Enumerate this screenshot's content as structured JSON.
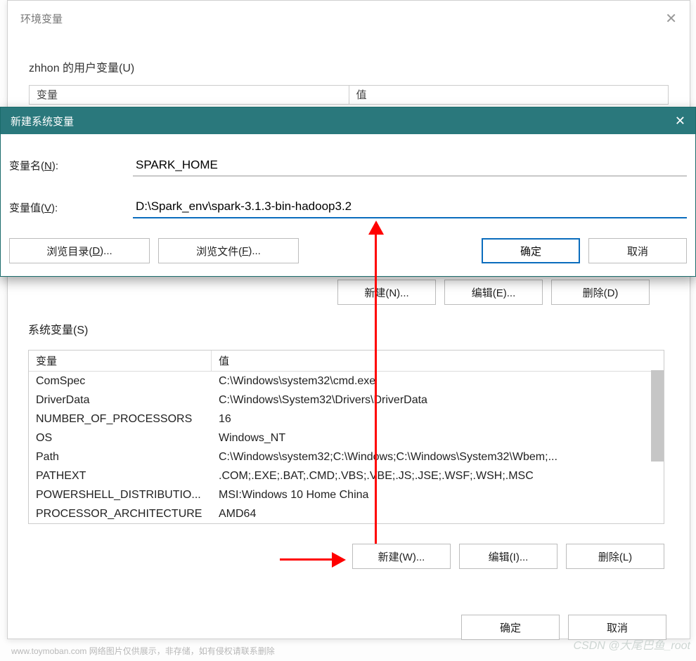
{
  "outerDialog": {
    "title": "环境变量",
    "userVarsHeading": "zhhon 的用户变量(U)",
    "userHeaders": {
      "variable": "变量",
      "value": "值"
    },
    "upperButtons": {
      "new": "新建(N)...",
      "edit": "编辑(E)...",
      "delete": "删除(D)"
    },
    "okcancel": {
      "ok": "确定",
      "cancel": "取消"
    }
  },
  "newSysVar": {
    "title": "新建系统变量",
    "nameLabel": "变量名(N):",
    "nameValue": "SPARK_HOME",
    "valueLabel": "变量值(V):",
    "valueValue": "D:\\Spark_env\\spark-3.1.3-bin-hadoop3.2",
    "browseDir": "浏览目录(D)...",
    "browseFile": "浏览文件(F)...",
    "ok": "确定",
    "cancel": "取消"
  },
  "sysVars": {
    "heading": "系统变量(S)",
    "headers": {
      "variable": "变量",
      "value": "值"
    },
    "rows": [
      {
        "variable": "ComSpec",
        "value": "C:\\Windows\\system32\\cmd.exe"
      },
      {
        "variable": "DriverData",
        "value": "C:\\Windows\\System32\\Drivers\\DriverData"
      },
      {
        "variable": "NUMBER_OF_PROCESSORS",
        "value": "16"
      },
      {
        "variable": "OS",
        "value": "Windows_NT"
      },
      {
        "variable": "Path",
        "value": "C:\\Windows\\system32;C:\\Windows;C:\\Windows\\System32\\Wbem;..."
      },
      {
        "variable": "PATHEXT",
        "value": ".COM;.EXE;.BAT;.CMD;.VBS;.VBE;.JS;.JSE;.WSF;.WSH;.MSC"
      },
      {
        "variable": "POWERSHELL_DISTRIBUTIO...",
        "value": "MSI:Windows 10 Home China"
      },
      {
        "variable": "PROCESSOR_ARCHITECTURE",
        "value": "AMD64"
      }
    ],
    "buttons": {
      "new": "新建(W)...",
      "edit": "编辑(I)...",
      "delete": "删除(L)"
    }
  },
  "footer": "www.toymoban.com 网络图片仅供展示，非存储，如有侵权请联系删除",
  "watermark": "CSDN @大尾巴鱼_root"
}
